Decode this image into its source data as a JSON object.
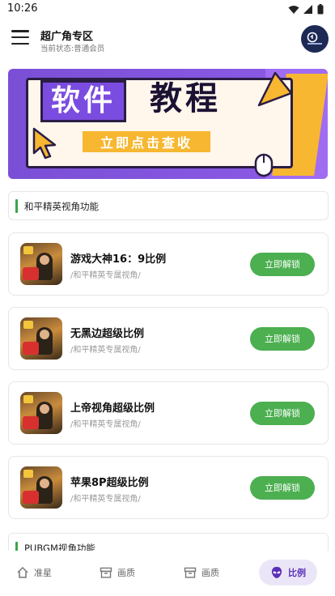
{
  "status_bar": {
    "time": "10:26"
  },
  "header": {
    "title": "超广角专区",
    "subtitle": "当前状态:普通会员"
  },
  "banner": {
    "title_left": "软件",
    "title_right": "教程",
    "cta": "立即点击查收"
  },
  "section_1": {
    "title": "和平精英视角功能"
  },
  "items": [
    {
      "title": "游戏大神16：9比例",
      "subtitle": "/和平精英专属视角/",
      "button": "立即解锁"
    },
    {
      "title": "无黑边超级比例",
      "subtitle": "/和平精英专属视角/",
      "button": "立即解锁"
    },
    {
      "title": "上帝视角超级比例",
      "subtitle": "/和平精英专属视角/",
      "button": "立即解锁"
    },
    {
      "title": "苹果8P超级比例",
      "subtitle": "/和平精英专属视角/",
      "button": "立即解锁"
    }
  ],
  "section_2": {
    "title": "PUBGM视角功能"
  },
  "bottom_nav": {
    "items": [
      {
        "label": "准星",
        "icon": "home-icon"
      },
      {
        "label": "画质",
        "icon": "archive-box-icon"
      },
      {
        "label": "画质",
        "icon": "archive-box-icon"
      },
      {
        "label": "比例",
        "icon": "alien-head-icon"
      }
    ],
    "active_index": 3
  },
  "colors": {
    "accent_green": "#4caf50",
    "accent_purple": "#7b4ce0",
    "banner_yellow": "#f7b731"
  }
}
